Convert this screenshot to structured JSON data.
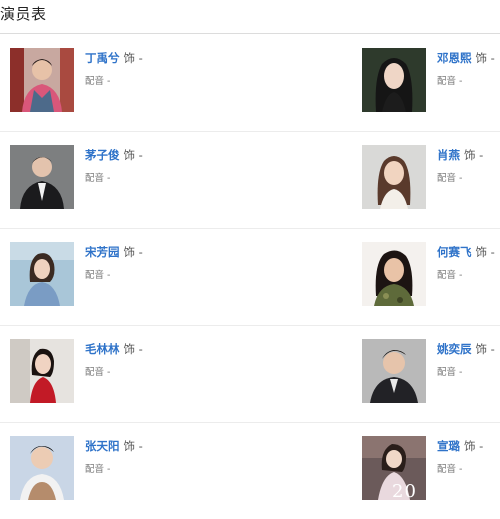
{
  "header": {
    "title": "演员表"
  },
  "cast": [
    {
      "left": {
        "name": "丁禹兮",
        "role": "饰 -",
        "voice": "配音  -"
      },
      "right": {
        "name": "邓恩熙",
        "role": "饰 -",
        "voice": "配音  -"
      }
    },
    {
      "left": {
        "name": "茅子俊",
        "role": "饰 -",
        "voice": "配音  -"
      },
      "right": {
        "name": "肖燕",
        "role": "饰 -",
        "voice": "配音  -"
      }
    },
    {
      "left": {
        "name": "宋芳园",
        "role": "饰 -",
        "voice": "配音  -"
      },
      "right": {
        "name": "何赛飞",
        "role": "饰 -",
        "voice": "配音  -"
      }
    },
    {
      "left": {
        "name": "毛林林",
        "role": "饰 -",
        "voice": "配音  -"
      },
      "right": {
        "name": "姚奕辰",
        "role": "饰 -",
        "voice": "配音  -"
      }
    },
    {
      "left": {
        "name": "张天阳",
        "role": "饰 -",
        "voice": "配音  -"
      },
      "right": {
        "name": "宣璐",
        "role": "饰 -",
        "voice": "配音  -"
      }
    }
  ],
  "watermark": "20",
  "colors": {
    "link": "#2f73c9",
    "divider": "#ececec",
    "header_rule": "#dcdcdc"
  }
}
